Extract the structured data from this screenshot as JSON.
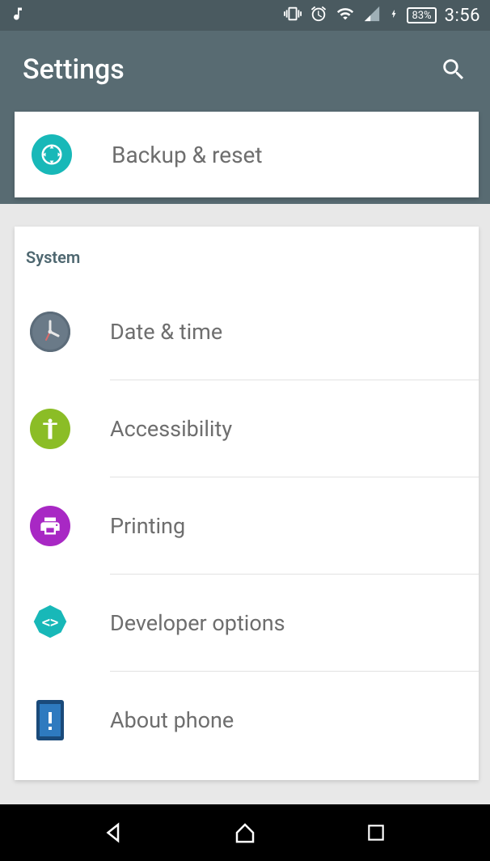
{
  "statusbar": {
    "battery_text": "83%",
    "clock": "3:56"
  },
  "appbar": {
    "title": "Settings"
  },
  "top_card": {
    "label": "Backup & reset"
  },
  "section": {
    "title": "System",
    "items": [
      {
        "label": "Date & time"
      },
      {
        "label": "Accessibility"
      },
      {
        "label": "Printing"
      },
      {
        "label": "Developer options"
      },
      {
        "label": "About phone"
      }
    ]
  }
}
